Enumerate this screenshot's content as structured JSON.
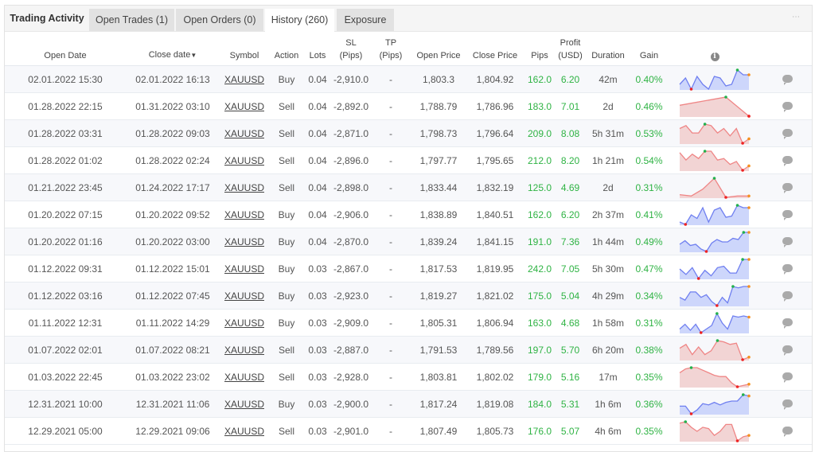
{
  "tabs": {
    "title": "Trading Activity",
    "items": [
      {
        "label": "Open Trades (1)",
        "active": false
      },
      {
        "label": "Open Orders (0)",
        "active": false
      },
      {
        "label": "History (260)",
        "active": true
      },
      {
        "label": "Exposure",
        "active": false
      }
    ],
    "more_icon": "⋯"
  },
  "table": {
    "headers": {
      "open_date": "Open Date",
      "close_date": "Close date",
      "sort_indicator": "▼",
      "symbol": "Symbol",
      "action": "Action",
      "lots": "Lots",
      "sl_1": "SL",
      "sl_2": "(Pips)",
      "tp_1": "TP",
      "tp_2": "(Pips)",
      "open_price": "Open Price",
      "close_price": "Close Price",
      "pips": "Pips",
      "profit_1": "Profit",
      "profit_2": "(USD)",
      "duration": "Duration",
      "gain": "Gain",
      "info_icon": "i"
    },
    "colors": {
      "buy_line": "#6f7ff0",
      "buy_fill": "#cdd6fb",
      "sell_line": "#ef8585",
      "sell_fill": "#f2d4d4",
      "max_dot": "#22b14c",
      "min_dot": "#ee2222",
      "end_dot": "#f5901e",
      "positive": "#2fb344"
    },
    "rows": [
      {
        "open_date": "02.01.2022 15:30",
        "close_date": "02.01.2022 16:13",
        "symbol": "XAUUSD",
        "action": "Buy",
        "lots": "0.04",
        "sl": "-2,910.0",
        "tp": "-",
        "open_price": "1,803.3",
        "close_price": "1,804.92",
        "pips": "162.0",
        "profit": "6.20",
        "duration": "42m",
        "gain": "0.40%",
        "spark": [
          5,
          9,
          2,
          10,
          5,
          2,
          10,
          9,
          4,
          5,
          14,
          11,
          11
        ]
      },
      {
        "open_date": "01.28.2022 22:15",
        "close_date": "01.31.2022 03:10",
        "symbol": "XAUUSD",
        "action": "Sell",
        "lots": "0.04",
        "sl": "-2,892.0",
        "tp": "-",
        "open_price": "1,788.79",
        "close_price": "1,786.96",
        "pips": "183.0",
        "profit": "7.01",
        "duration": "2d",
        "gain": "0.46%",
        "spark": [
          8,
          11,
          14,
          0
        ]
      },
      {
        "open_date": "01.28.2022 03:31",
        "close_date": "01.28.2022 09:03",
        "symbol": "XAUUSD",
        "action": "Sell",
        "lots": "0.04",
        "sl": "-2,871.0",
        "tp": "-",
        "open_price": "1,798.73",
        "close_price": "1,796.64",
        "pips": "209.0",
        "profit": "8.08",
        "duration": "5h 31m",
        "gain": "0.53%",
        "spark": [
          10,
          12,
          7,
          7,
          13,
          12,
          7,
          10,
          5,
          10,
          0,
          3
        ]
      },
      {
        "open_date": "01.28.2022 01:02",
        "close_date": "01.28.2022 02:24",
        "symbol": "XAUUSD",
        "action": "Sell",
        "lots": "0.04",
        "sl": "-2,896.0",
        "tp": "-",
        "open_price": "1,797.77",
        "close_price": "1,795.65",
        "pips": "212.0",
        "profit": "8.20",
        "duration": "1h 21m",
        "gain": "0.54%",
        "spark": [
          12,
          7,
          11,
          8,
          13,
          13,
          7,
          8,
          4,
          6,
          0,
          3
        ]
      },
      {
        "open_date": "01.21.2022 23:45",
        "close_date": "01.24.2022 17:17",
        "symbol": "XAUUSD",
        "action": "Sell",
        "lots": "0.04",
        "sl": "-2,898.0",
        "tp": "-",
        "open_price": "1,833.44",
        "close_price": "1,832.19",
        "pips": "125.0",
        "profit": "4.69",
        "duration": "2d",
        "gain": "0.31%",
        "spark": [
          2,
          1,
          6,
          14,
          0,
          1,
          1
        ]
      },
      {
        "open_date": "01.20.2022 07:15",
        "close_date": "01.20.2022 09:52",
        "symbol": "XAUUSD",
        "action": "Buy",
        "lots": "0.04",
        "sl": "-2,906.0",
        "tp": "-",
        "open_price": "1,838.89",
        "close_price": "1,840.51",
        "pips": "162.0",
        "profit": "6.20",
        "duration": "2h 37m",
        "gain": "0.41%",
        "spark": [
          2,
          0,
          8,
          5,
          14,
          2,
          12,
          14,
          6,
          7,
          16,
          14,
          14
        ]
      },
      {
        "open_date": "01.20.2022 01:16",
        "close_date": "01.20.2022 03:00",
        "symbol": "XAUUSD",
        "action": "Buy",
        "lots": "0.04",
        "sl": "-2,870.0",
        "tp": "-",
        "open_price": "1,839.24",
        "close_price": "1,841.15",
        "pips": "191.0",
        "profit": "7.36",
        "duration": "1h 44m",
        "gain": "0.49%",
        "spark": [
          6,
          9,
          5,
          6,
          2,
          0,
          7,
          10,
          8,
          8,
          11,
          10,
          16,
          16
        ]
      },
      {
        "open_date": "01.12.2022 09:31",
        "close_date": "01.12.2022 15:01",
        "symbol": "XAUUSD",
        "action": "Buy",
        "lots": "0.03",
        "sl": "-2,867.0",
        "tp": "-",
        "open_price": "1,817.53",
        "close_price": "1,819.95",
        "pips": "242.0",
        "profit": "7.05",
        "duration": "5h 30m",
        "gain": "0.47%",
        "spark": [
          7,
          3,
          8,
          0,
          6,
          2,
          8,
          9,
          4,
          4,
          14,
          14
        ]
      },
      {
        "open_date": "01.12.2022 03:16",
        "close_date": "01.12.2022 07:45",
        "symbol": "XAUUSD",
        "action": "Buy",
        "lots": "0.03",
        "sl": "-2,923.0",
        "tp": "-",
        "open_price": "1,819.27",
        "close_price": "1,821.02",
        "pips": "175.0",
        "profit": "5.04",
        "duration": "4h 29m",
        "gain": "0.34%",
        "spark": [
          6,
          4,
          10,
          10,
          6,
          8,
          3,
          0,
          6,
          2,
          14,
          13,
          14,
          14
        ]
      },
      {
        "open_date": "01.11.2022 12:31",
        "close_date": "01.11.2022 14:29",
        "symbol": "XAUUSD",
        "action": "Buy",
        "lots": "0.03",
        "sl": "-2,909.0",
        "tp": "-",
        "open_price": "1,805.31",
        "close_price": "1,806.94",
        "pips": "163.0",
        "profit": "4.68",
        "duration": "1h 58m",
        "gain": "0.31%",
        "spark": [
          3,
          7,
          2,
          7,
          0,
          3,
          6,
          16,
          8,
          3,
          14,
          13,
          14,
          13
        ]
      },
      {
        "open_date": "01.07.2022 02:01",
        "close_date": "01.07.2022 08:21",
        "symbol": "XAUUSD",
        "action": "Sell",
        "lots": "0.03",
        "sl": "-2,887.0",
        "tp": "-",
        "open_price": "1,791.53",
        "close_price": "1,789.56",
        "pips": "197.0",
        "profit": "5.70",
        "duration": "6h 20m",
        "gain": "0.38%",
        "spark": [
          9,
          12,
          4,
          10,
          4,
          7,
          15,
          14,
          12,
          13,
          0,
          2
        ]
      },
      {
        "open_date": "01.03.2022 22:45",
        "close_date": "01.03.2022 23:02",
        "symbol": "XAUUSD",
        "action": "Sell",
        "lots": "0.03",
        "sl": "-2,928.0",
        "tp": "-",
        "open_price": "1,803.81",
        "close_price": "1,802.02",
        "pips": "179.0",
        "profit": "5.16",
        "duration": "17m",
        "gain": "0.35%",
        "spark": [
          11,
          14,
          15,
          15,
          13,
          11,
          9,
          8,
          8,
          3,
          0,
          1,
          2
        ]
      },
      {
        "open_date": "12.31.2021 10:00",
        "close_date": "12.31.2021 11:06",
        "symbol": "XAUUSD",
        "action": "Buy",
        "lots": "0.03",
        "sl": "-2,900.0",
        "tp": "-",
        "open_price": "1,817.24",
        "close_price": "1,819.08",
        "pips": "184.0",
        "profit": "5.31",
        "duration": "1h 6m",
        "gain": "0.36%",
        "spark": [
          6,
          6,
          0,
          3,
          8,
          7,
          9,
          7,
          9,
          10,
          10,
          15,
          14
        ]
      },
      {
        "open_date": "12.29.2021 05:00",
        "close_date": "12.29.2021 09:06",
        "symbol": "XAUUSD",
        "action": "Sell",
        "lots": "0.03",
        "sl": "-2,901.0",
        "tp": "-",
        "open_price": "1,807.49",
        "close_price": "1,805.73",
        "pips": "176.0",
        "profit": "5.07",
        "duration": "4h 6m",
        "gain": "0.35%",
        "spark": [
          13,
          14,
          10,
          7,
          10,
          9,
          4,
          7,
          12,
          12,
          0,
          3,
          4
        ]
      }
    ]
  }
}
